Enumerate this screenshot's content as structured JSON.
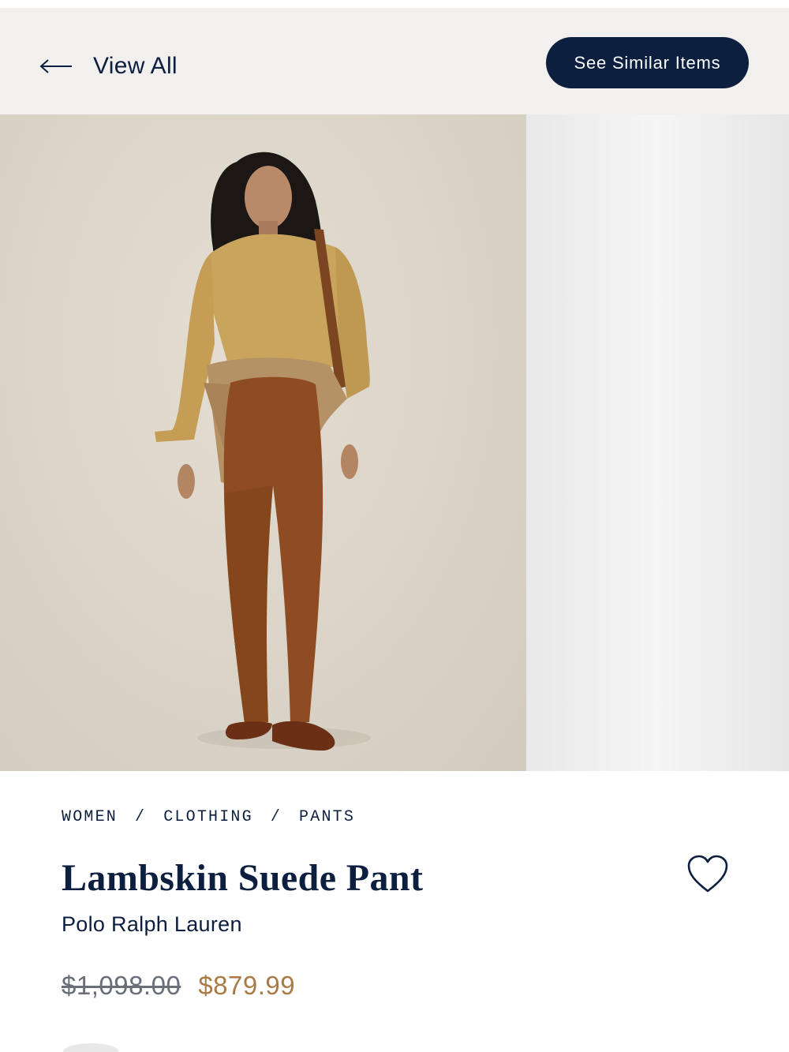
{
  "header": {
    "back_label": "View All",
    "similar_label": "See Similar Items"
  },
  "gallery": {
    "current_image": "model wearing lambskin suede pant",
    "next_image": "next product image"
  },
  "breadcrumb": [
    "WOMEN",
    "CLOTHING",
    "PANTS"
  ],
  "breadcrumb_separator": "/",
  "product": {
    "name": "Lambskin Suede Pant",
    "brand": "Polo Ralph Lauren",
    "original_price": "$1,098.00",
    "sale_price": "$879.99"
  },
  "icons": {
    "back": "left-arrow-icon",
    "wishlist": "heart-icon"
  },
  "colors": {
    "navy": "#0c1f3f",
    "sale": "#a97a46",
    "strike": "#6a6e78",
    "header_bg": "#f1f0ee"
  }
}
